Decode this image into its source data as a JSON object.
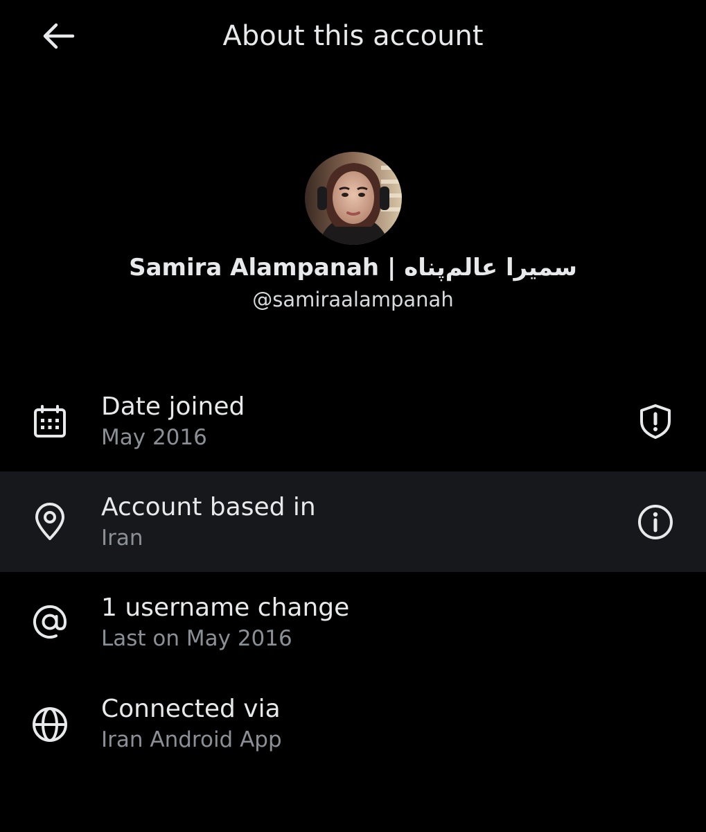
{
  "header": {
    "title": "About this account",
    "back_icon": "arrow-left-icon"
  },
  "profile": {
    "display_name": "Samira Alampanah | سمیرا عالم‌پناه",
    "handle": "@samiraalampanah",
    "avatar": "profile-photo"
  },
  "rows": [
    {
      "icon": "calendar-icon",
      "title": "Date joined",
      "subtitle": "May 2016",
      "action_icon": "shield-alert-icon"
    },
    {
      "icon": "location-pin-icon",
      "title": "Account based in",
      "subtitle": "Iran",
      "action_icon": "info-icon"
    },
    {
      "icon": "at-sign-icon",
      "title": "1 username change",
      "subtitle": "Last on May 2016"
    },
    {
      "icon": "globe-icon",
      "title": "Connected via",
      "subtitle": "Iran Android App"
    }
  ],
  "colors": {
    "background": "#000000",
    "text_primary": "#e7e9ea",
    "text_secondary": "#8b9096",
    "highlight_row": "#16181c"
  }
}
